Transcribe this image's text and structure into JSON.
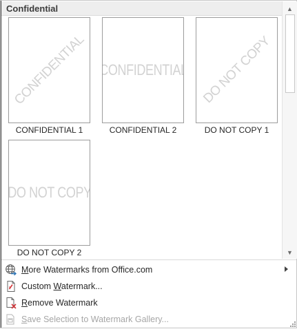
{
  "gallery": {
    "section_title": "Confidential",
    "tiles": [
      {
        "caption": "CONFIDENTIAL 1",
        "watermark": "CONFIDENTIAL",
        "orientation": "diagonal"
      },
      {
        "caption": "CONFIDENTIAL 2",
        "watermark": "CONFIDENTIAL",
        "orientation": "horizontal"
      },
      {
        "caption": "DO NOT COPY 1",
        "watermark": "DO NOT COPY",
        "orientation": "diagonal"
      },
      {
        "caption": "DO NOT COPY 2",
        "watermark": "DO NOT COPY",
        "orientation": "horizontal"
      }
    ]
  },
  "scrollbar": {
    "up_icon": "▲",
    "down_icon": "▼",
    "position_fraction": 0
  },
  "menu": {
    "items": [
      {
        "label": "More Watermarks from Office.com",
        "icon": "globe-arrow-icon",
        "enabled": true,
        "has_submenu": true
      },
      {
        "label": "Custom Watermark...",
        "icon": "custom-document-icon",
        "enabled": true,
        "has_submenu": false
      },
      {
        "label": "Remove Watermark",
        "icon": "remove-document-icon",
        "enabled": true,
        "has_submenu": false
      },
      {
        "label": "Save Selection to Watermark Gallery...",
        "icon": "save-to-gallery-icon",
        "enabled": false,
        "has_submenu": false
      }
    ]
  },
  "colors": {
    "accent_blue": "#2e75b6",
    "delete_red": "#d13438",
    "watermark_gray": "#d2d2d2",
    "disabled_gray": "#a6a6a6"
  }
}
